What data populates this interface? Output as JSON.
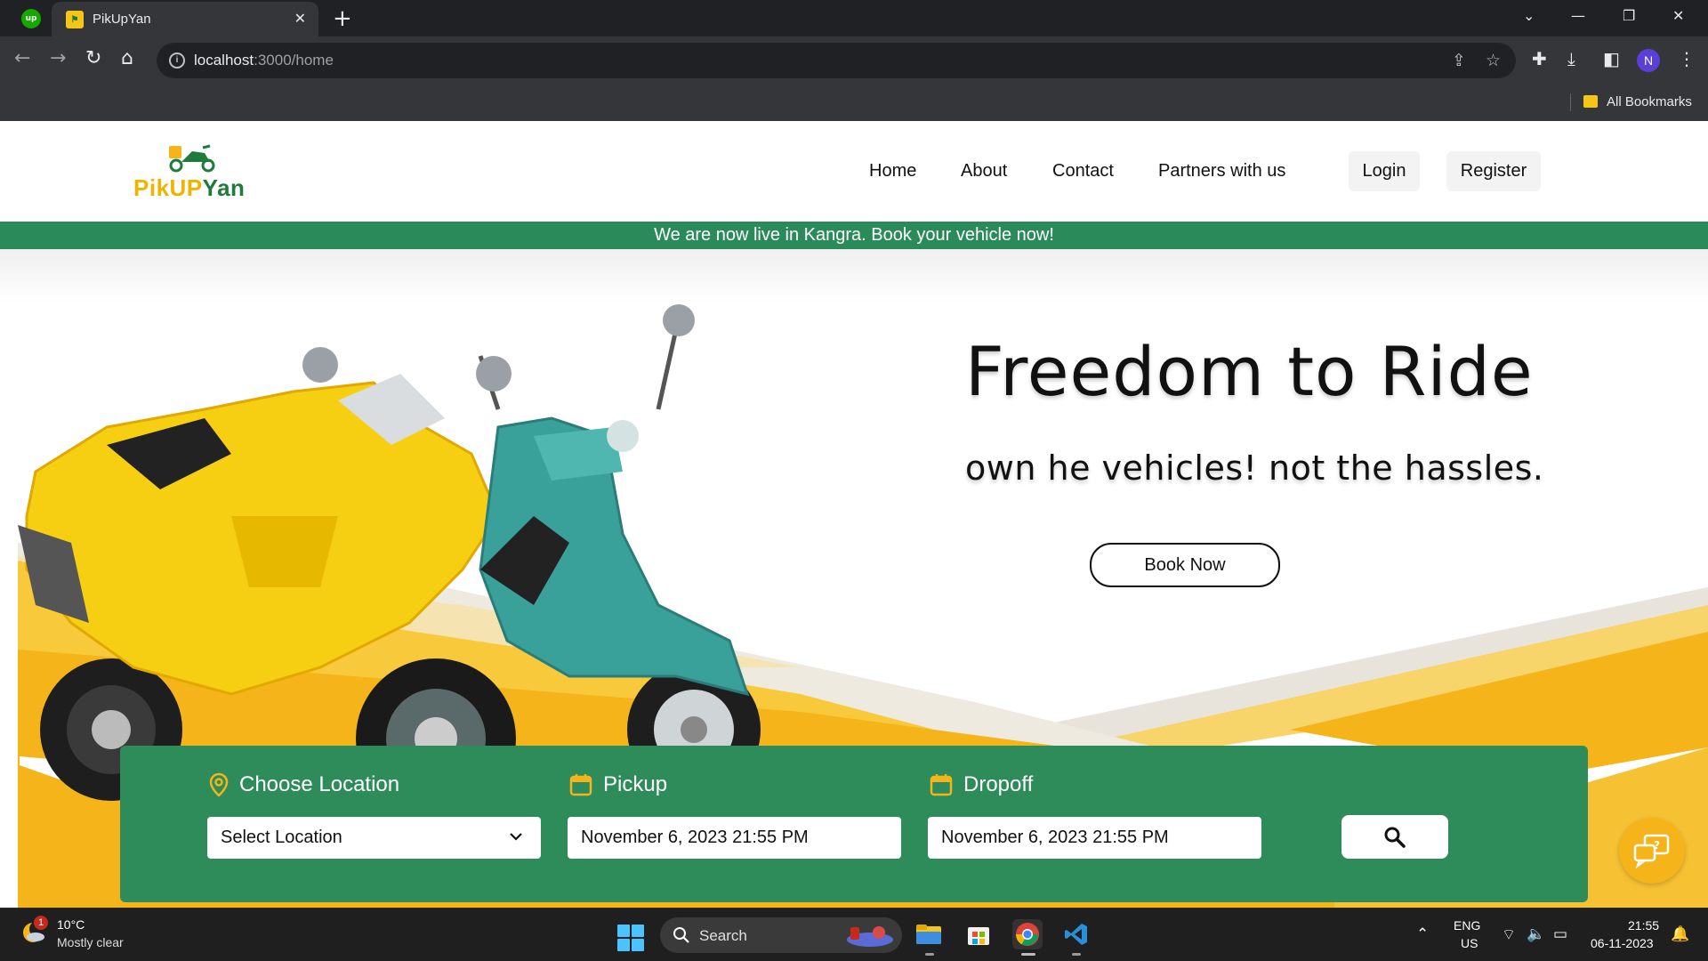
{
  "browser": {
    "tab_title": "PikUpYan",
    "url_host": "localhost",
    "url_path": ":3000/home",
    "profile_initial": "N",
    "bookmarks_label": "All Bookmarks"
  },
  "site": {
    "logo": {
      "part1": "Pik",
      "part2": "UP",
      "part3": "Yan"
    },
    "nav": {
      "home": "Home",
      "about": "About",
      "contact": "Contact",
      "partners": "Partners with us",
      "login": "Login",
      "register": "Register"
    },
    "banner": "We are now live in Kangra. Book your vehicle now!",
    "hero": {
      "title": "Freedom to Ride",
      "subtitle": "own he vehicles! not the hassles.",
      "cta": "Book Now"
    },
    "search": {
      "location_label": "Choose Location",
      "location_value": "Select Location",
      "pickup_label": "Pickup",
      "pickup_value": "November 6, 2023  21:55 PM",
      "dropoff_label": "Dropoff",
      "dropoff_value": "November 6, 2023  21:55 PM"
    },
    "colors": {
      "brand_green": "#2e8b5a",
      "brand_yellow": "#f4b41a"
    }
  },
  "taskbar": {
    "weather_badge": "1",
    "weather_temp": "10°C",
    "weather_desc": "Mostly clear",
    "search_label": "Search",
    "lang_top": "ENG",
    "lang_bottom": "US",
    "time": "21:55",
    "date": "06-11-2023"
  }
}
